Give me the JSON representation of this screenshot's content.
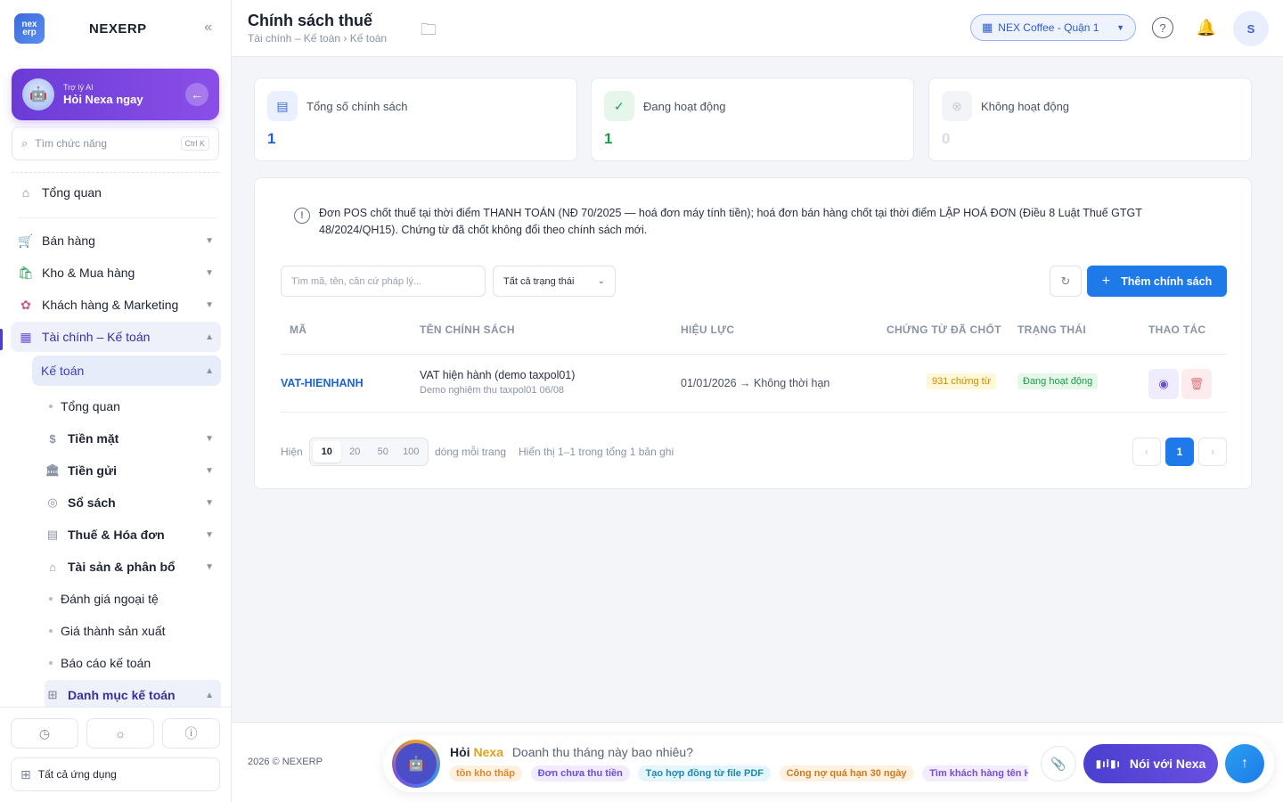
{
  "brand": {
    "name": "NEXERP",
    "logo_text": "nex erp",
    "collapse_icon": "«"
  },
  "ai_card": {
    "subtitle": "Trợ lý AI",
    "title": "Hỏi Nexa ngay"
  },
  "search": {
    "placeholder": "Tìm chức năng",
    "shortcut": "Ctrl K"
  },
  "nav": {
    "overview": "Tổng quan",
    "sales": "Bán hàng",
    "inventory": "Kho & Mua hàng",
    "customers": "Khách hàng & Marketing",
    "finance": "Tài chính – Kế toán",
    "accounting": "Kế toán",
    "sub": {
      "overview": "Tổng quan",
      "cash": "Tiền mặt",
      "deposit": "Tiền gửi",
      "books": "Sổ sách",
      "tax": "Thuế & Hóa đơn",
      "assets": "Tài sản & phân bổ",
      "fx": "Đánh giá ngoại tệ",
      "cost": "Giá thành sản xuất",
      "report": "Báo cáo kế toán",
      "catalog": "Danh mục kế toán"
    }
  },
  "sidebar_bottom": {
    "all_apps": "Tất cả ứng dụng"
  },
  "header": {
    "title": "Chính sách thuế",
    "breadcrumb": "Tài chính – Kế toán › Kế toán",
    "store": "NEX Coffee - Quận 1",
    "avatar": "S"
  },
  "stats": [
    {
      "label": "Tổng số chính sách",
      "value": "1",
      "color": "#1e63d6"
    },
    {
      "label": "Đang hoạt động",
      "value": "1",
      "color": "#1e9a4a"
    },
    {
      "label": "Không hoạt động",
      "value": "0",
      "color": "#d8dce4"
    }
  ],
  "notice": "Đơn POS chốt thuế tại thời điểm THANH TOÁN (NĐ 70/2025 — hoá đơn máy tính tiền); hoá đơn bán hàng chốt tại thời điểm LẬP HOÁ ĐƠN (Điều 8 Luật Thuế GTGT 48/2024/QH15). Chứng từ đã chốt không đổi theo chính sách mới.",
  "toolbar": {
    "search_placeholder": "Tìm mã, tên, căn cứ pháp lý...",
    "status_filter": "Tất cả trạng thái",
    "add_label": "Thêm chính sách"
  },
  "table": {
    "columns": [
      "MÃ",
      "TÊN CHÍNH SÁCH",
      "HIỆU LỰC",
      "CHỨNG TỪ ĐÃ CHỐT",
      "TRẠNG THÁI",
      "THAO TÁC"
    ],
    "rows": [
      {
        "code": "VAT-HIENHANH",
        "name": "VAT hiện hành (demo taxpol01)",
        "desc": "Demo nghiệm thu taxpol01 06/08",
        "validity": "01/01/2026 → Không thời hạn",
        "docs": "931 chứng từ",
        "status": "Đang hoạt động"
      }
    ]
  },
  "pagination": {
    "show_label": "Hiện",
    "sizes": [
      "10",
      "20",
      "50",
      "100"
    ],
    "per_page_label": "dòng mỗi trang",
    "summary": "Hiển thị 1–1 trong tổng 1 bản ghi",
    "current_page": "1"
  },
  "footer": {
    "copyright": "2026 © NEXERP",
    "ask_hoi": "Hỏi",
    "ask_nexa": "Nexa",
    "ask_placeholder": "Doanh thu tháng này bao nhiêu?",
    "chips": [
      {
        "label": "tồn kho thấp",
        "bg": "#fff1e2",
        "fg": "#e08a2a"
      },
      {
        "label": "Đơn chưa thu tiền",
        "bg": "#f0ebfd",
        "fg": "#6a4fd6"
      },
      {
        "label": "Tạo hợp đồng từ file PDF",
        "bg": "#e4f5fb",
        "fg": "#1e8ab0"
      },
      {
        "label": "Công nợ quá hạn 30 ngày",
        "bg": "#fff1e2",
        "fg": "#d07a1a"
      },
      {
        "label": "Tìm khách hàng tên H",
        "bg": "#f3ecfd",
        "fg": "#7a4fd6"
      }
    ],
    "talk_label": "Nói với Nexa"
  }
}
